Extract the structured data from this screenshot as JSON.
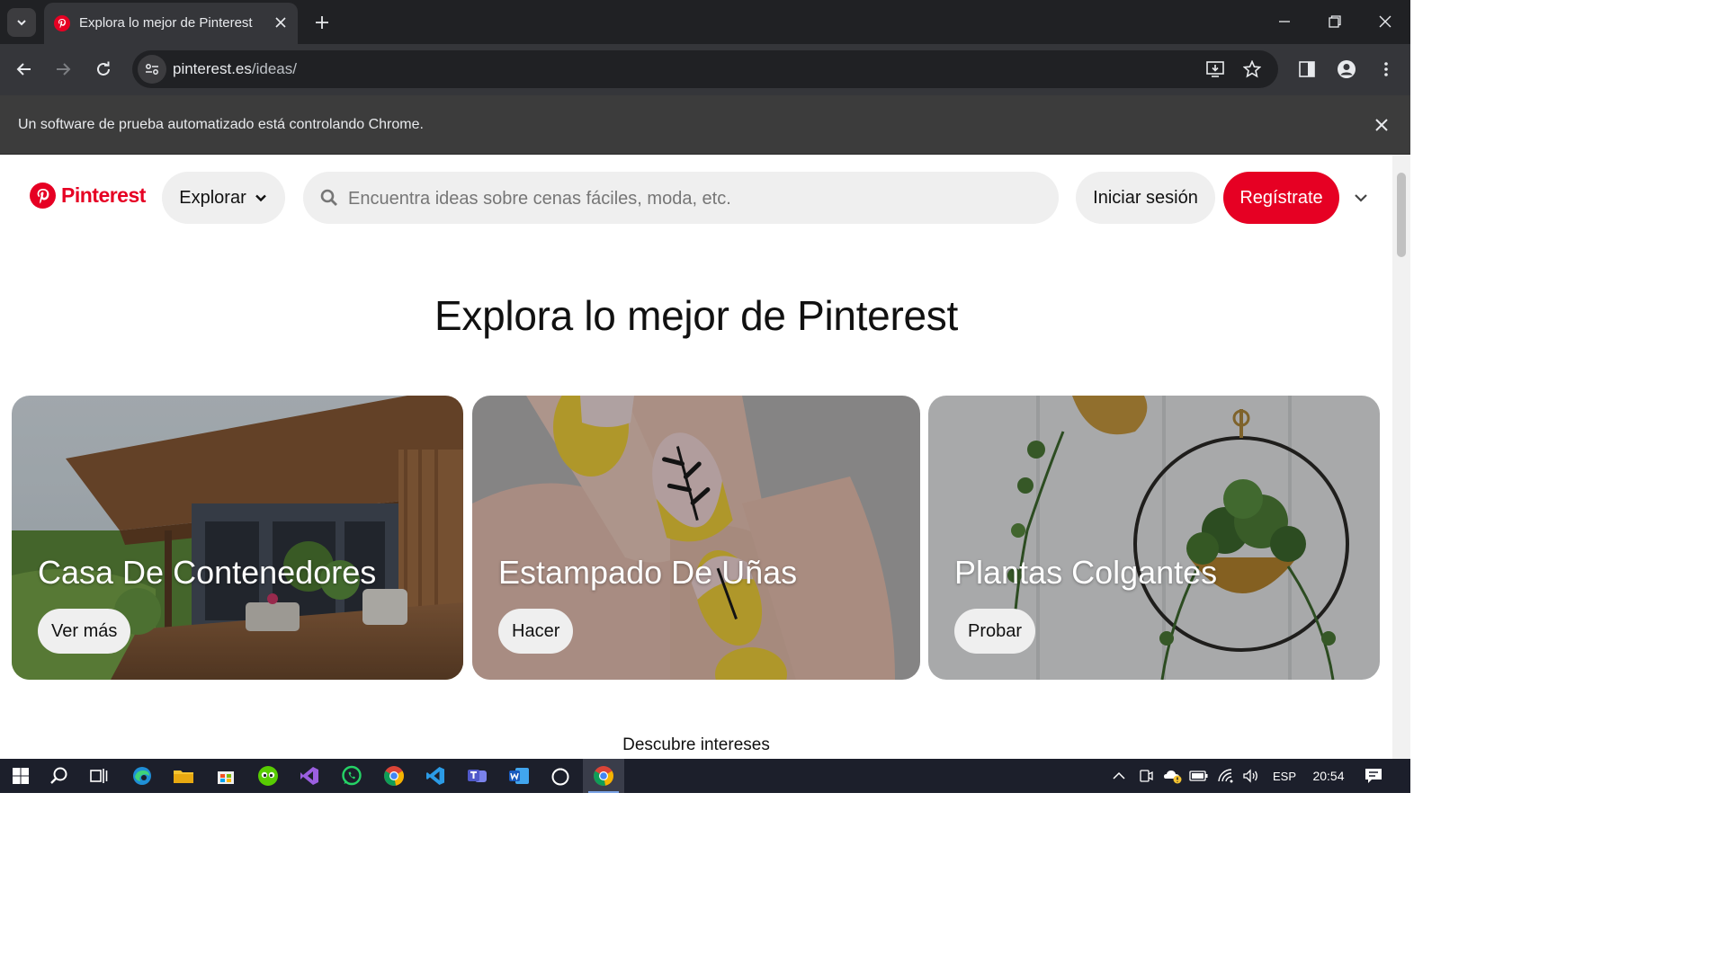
{
  "browser": {
    "tab": {
      "title": "Explora lo mejor de Pinterest",
      "favicon": "pinterest-icon"
    },
    "address_bar": {
      "domain": "pinterest.es",
      "path": "/ideas/"
    },
    "infobar_text": "Un software de prueba automatizado está controlando Chrome."
  },
  "page": {
    "logo_text": "Pinterest",
    "explore_label": "Explorar",
    "search_placeholder": "Encuentra ideas sobre cenas fáciles, moda, etc.",
    "login_label": "Iniciar sesión",
    "signup_label": "Regístrate",
    "hero_title": "Explora lo mejor de Pinterest",
    "cards": [
      {
        "title": "Casa De Contenedores",
        "button": "Ver más"
      },
      {
        "title": "Estampado De Uñas",
        "button": "Hacer"
      },
      {
        "title": "Plantas Colgantes",
        "button": "Probar"
      }
    ],
    "discover_label": "Descubre intereses"
  },
  "taskbar": {
    "apps": [
      "windows-start-icon",
      "search-icon",
      "task-view-icon",
      "edge-icon",
      "file-explorer-icon",
      "microsoft-store-icon",
      "duolingo-icon",
      "visual-studio-icon",
      "whatsapp-icon",
      "chrome-icon",
      "vscode-icon",
      "teams-icon",
      "word-icon",
      "obs-icon",
      "chrome-active-icon"
    ],
    "language": "ESP",
    "time": "20:54"
  },
  "colors": {
    "brand": "#e60023",
    "chrome_dark": "#202124",
    "chrome_toolbar": "#35363a",
    "taskbar": "#1c1f2b"
  }
}
